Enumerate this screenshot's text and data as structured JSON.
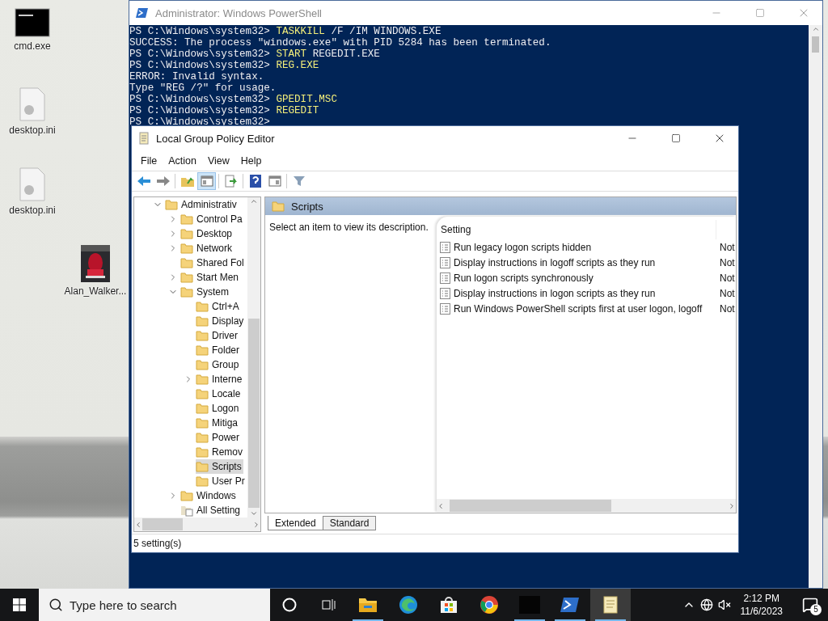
{
  "desktop_icons": [
    {
      "label": "cmd.exe",
      "kind": "console"
    },
    {
      "label": "desktop.ini",
      "kind": "settings-file"
    },
    {
      "label": "desktop.ini",
      "kind": "settings-file"
    },
    {
      "label": "Alan_Walker...",
      "kind": "picture"
    }
  ],
  "powershell": {
    "title": "Administrator: Windows PowerShell",
    "lines": [
      {
        "kind": "command",
        "prompt": "PS C:\\Windows\\system32>",
        "command": "TASKKILL",
        "arguments": "/F /IM WINDOWS.EXE"
      },
      {
        "kind": "output",
        "text": "SUCCESS: The process \"windows.exe\" with PID 5284 has been terminated."
      },
      {
        "kind": "command",
        "prompt": "PS C:\\Windows\\system32>",
        "command": "START",
        "arguments": "REGEDIT.EXE"
      },
      {
        "kind": "command",
        "prompt": "PS C:\\Windows\\system32>",
        "command": "REG.EXE"
      },
      {
        "kind": "output",
        "text": "ERROR: Invalid syntax."
      },
      {
        "kind": "output",
        "text": "Type \"REG /?\" for usage."
      },
      {
        "kind": "command",
        "prompt": "PS C:\\Windows\\system32>",
        "command": "GPEDIT.MSC"
      },
      {
        "kind": "command",
        "prompt": "PS C:\\Windows\\system32>",
        "command": "REGEDIT"
      },
      {
        "kind": "command",
        "prompt": "PS C:\\Windows\\system32>"
      }
    ]
  },
  "gpedit": {
    "title": "Local Group Policy Editor",
    "menu": [
      "File",
      "Action",
      "View",
      "Help"
    ],
    "toolbar": [
      {
        "kind": "back",
        "pressed": false
      },
      {
        "kind": "forward",
        "pressed": false
      },
      {
        "kind": "separator"
      },
      {
        "kind": "up",
        "pressed": false
      },
      {
        "kind": "tree",
        "pressed": true
      },
      {
        "kind": "separator"
      },
      {
        "kind": "export",
        "pressed": false
      },
      {
        "kind": "separator"
      },
      {
        "kind": "help",
        "pressed": false
      },
      {
        "kind": "view",
        "pressed": false
      },
      {
        "kind": "separator"
      },
      {
        "kind": "filter",
        "pressed": false
      }
    ],
    "tree": [
      {
        "label": "Administrativ",
        "kind": "folder",
        "expanded": true,
        "selected": false,
        "children": [
          {
            "label": "Control Pa",
            "kind": "folder",
            "expanded": false,
            "selected": false
          },
          {
            "label": "Desktop",
            "kind": "folder",
            "expanded": false,
            "selected": false
          },
          {
            "label": "Network",
            "kind": "folder",
            "expanded": false,
            "selected": false
          },
          {
            "label": "Shared Fol",
            "kind": "folder",
            "selected": false
          },
          {
            "label": "Start Men",
            "kind": "folder",
            "expanded": false,
            "selected": false
          },
          {
            "label": "System",
            "kind": "folder",
            "expanded": true,
            "selected": false,
            "children": [
              {
                "label": "Ctrl+A",
                "kind": "folder",
                "selected": false
              },
              {
                "label": "Display",
                "kind": "folder",
                "selected": false
              },
              {
                "label": "Driver",
                "kind": "folder",
                "selected": false
              },
              {
                "label": "Folder",
                "kind": "folder",
                "selected": false
              },
              {
                "label": "Group",
                "kind": "folder",
                "selected": false
              },
              {
                "label": "Interne",
                "kind": "folder",
                "expanded": false,
                "selected": false
              },
              {
                "label": "Locale",
                "kind": "folder",
                "selected": false
              },
              {
                "label": "Logon",
                "kind": "folder",
                "selected": false
              },
              {
                "label": "Mitiga",
                "kind": "folder",
                "selected": false
              },
              {
                "label": "Power",
                "kind": "folder",
                "selected": false
              },
              {
                "label": "Remov",
                "kind": "folder",
                "selected": false
              },
              {
                "label": "Scripts",
                "kind": "folder",
                "selected": true
              },
              {
                "label": "User Pr",
                "kind": "folder",
                "selected": false
              }
            ]
          },
          {
            "label": "Windows",
            "kind": "folder",
            "expanded": false,
            "selected": false
          },
          {
            "label": "All Setting",
            "kind": "settings",
            "selected": false
          }
        ]
      }
    ],
    "header": "Scripts",
    "description": "Select an item to view its description.",
    "columns": [
      "Setting"
    ],
    "settings": [
      {
        "name": "Run legacy logon scripts hidden",
        "state": "Not"
      },
      {
        "name": "Display instructions in logoff scripts as they run",
        "state": "Not"
      },
      {
        "name": "Run logon scripts synchronously",
        "state": "Not"
      },
      {
        "name": "Display instructions in logon scripts as they run",
        "state": "Not"
      },
      {
        "name": "Run Windows PowerShell scripts first at user logon, logoff",
        "state": "Not"
      }
    ],
    "tabs": [
      {
        "label": "Extended",
        "selected": true
      },
      {
        "label": "Standard",
        "selected": false
      }
    ],
    "status_bar": "5 setting(s)"
  },
  "taskbar": {
    "search": {
      "placeholder": "Type here to search"
    },
    "apps": [
      {
        "kind": "explorer",
        "running": true,
        "selected": false
      },
      {
        "kind": "edge",
        "running": false,
        "selected": false
      },
      {
        "kind": "store",
        "running": false,
        "selected": false
      },
      {
        "kind": "chrome",
        "running": false,
        "selected": false
      },
      {
        "kind": "dark-app",
        "running": true,
        "selected": false
      },
      {
        "kind": "powershell",
        "running": true,
        "selected": false
      },
      {
        "kind": "gpedit",
        "running": true,
        "selected": true
      }
    ],
    "time": "2:12 PM",
    "date": "11/6/2023",
    "notifications": "5"
  }
}
